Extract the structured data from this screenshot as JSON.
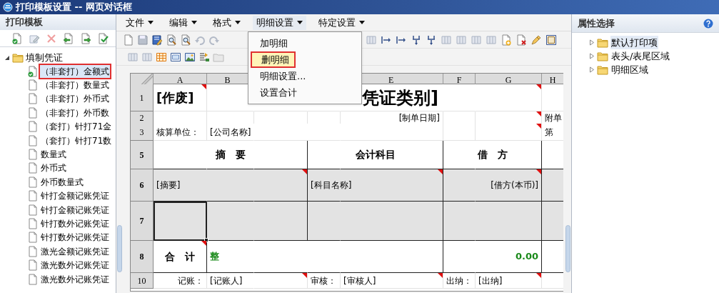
{
  "window": {
    "title": "打印模板设置 -- 网页对话框"
  },
  "left_panel": {
    "title": "打印模板",
    "tree": [
      {
        "label": "填制凭证",
        "expanded": true,
        "children": [
          {
            "label": "（非套打）金额式",
            "checked": true,
            "selected": true
          },
          {
            "label": "（非套打）数量式",
            "checked": false,
            "selected": false
          },
          {
            "label": "（非套打）外币式",
            "checked": false,
            "selected": false
          },
          {
            "label": "（非套打）外币数",
            "checked": false,
            "selected": false
          },
          {
            "label": "（套打）针打71金",
            "checked": false,
            "selected": false
          },
          {
            "label": "（套打）针打71数",
            "checked": false,
            "selected": false
          },
          {
            "label": "数量式",
            "checked": false,
            "selected": false
          },
          {
            "label": "外币式",
            "checked": false,
            "selected": false
          },
          {
            "label": "外币数量式",
            "checked": false,
            "selected": false
          },
          {
            "label": "针打金额记账凭证",
            "checked": false,
            "selected": false
          },
          {
            "label": "针打金额记账凭证",
            "checked": false,
            "selected": false
          },
          {
            "label": "针打数外记账凭证",
            "checked": false,
            "selected": false
          },
          {
            "label": "针打数外记账凭证",
            "checked": false,
            "selected": false
          },
          {
            "label": "激光金额记账凭证",
            "checked": false,
            "selected": false
          },
          {
            "label": "激光数外记账凭证",
            "checked": false,
            "selected": false
          },
          {
            "label": "激光数外记账凭证",
            "checked": false,
            "selected": false
          }
        ]
      }
    ]
  },
  "menubar": [
    {
      "label": "文件",
      "open": false
    },
    {
      "label": "编辑",
      "open": false
    },
    {
      "label": "格式",
      "open": false
    },
    {
      "label": "明细设置",
      "open": true,
      "items": [
        {
          "label": "加明细",
          "selected": false
        },
        {
          "label": "删明细",
          "selected": true
        },
        {
          "label": "明细设置...",
          "selected": false
        },
        {
          "label": "设置合计",
          "selected": false
        }
      ]
    },
    {
      "label": "特定设置",
      "open": false
    }
  ],
  "sheet": {
    "columns": [
      "A",
      "B",
      "",
      "",
      "E",
      "F",
      "G",
      "H"
    ],
    "rows": [
      {
        "number": "1",
        "kind": "plain",
        "cells": [
          {
            "text": "[作废]",
            "kind": "title-small",
            "flag": true,
            "selected": false
          },
          {
            "text": "",
            "flag": false,
            "selected": false
          },
          {
            "text": "",
            "flag": false,
            "selected": false
          },
          {
            "text": "",
            "flag": false,
            "selected": false
          },
          {
            "text": "凭证类别]",
            "kind": "title",
            "flag": false,
            "selected": false
          },
          {
            "text": "",
            "flag": false,
            "selected": false
          },
          {
            "text": "",
            "flag": true,
            "selected": false
          },
          {
            "text": "",
            "flag": false,
            "selected": false
          }
        ]
      },
      {
        "number": "2",
        "kind": "plain",
        "cells": [
          {
            "text": "",
            "flag": false,
            "selected": false
          },
          {
            "text": "",
            "flag": false,
            "selected": false
          },
          {
            "text": "",
            "flag": false,
            "selected": false
          },
          {
            "text": "",
            "flag": false,
            "selected": false
          },
          {
            "text": "[制单日期]",
            "kind": "field-right",
            "flag": false,
            "selected": false
          },
          {
            "text": "",
            "flag": false,
            "selected": false
          },
          {
            "text": "",
            "flag": true,
            "selected": false
          },
          {
            "text": "附单",
            "kind": "field",
            "flag": false,
            "selected": false
          }
        ]
      },
      {
        "number": "3",
        "kind": "plain",
        "cells": [
          {
            "text": "核算单位：",
            "kind": "field",
            "flag": false,
            "selected": false
          },
          {
            "text": "[公司名称]",
            "kind": "field",
            "flag": false,
            "selected": false
          },
          {
            "text": "",
            "flag": false,
            "selected": false
          },
          {
            "text": "",
            "flag": false,
            "selected": false
          },
          {
            "text": "",
            "flag": false,
            "selected": false
          },
          {
            "text": "",
            "flag": false,
            "selected": false
          },
          {
            "text": "",
            "flag": true,
            "selected": false
          },
          {
            "text": "第",
            "kind": "field",
            "flag": false,
            "selected": false
          }
        ]
      },
      {
        "number": "5",
        "kind": "table",
        "cells": [
          {
            "text": "",
            "flag": false,
            "selected": false
          },
          {
            "text": "摘　要",
            "kind": "heading",
            "flag": false,
            "selected": false
          },
          {
            "text": "",
            "flag": false,
            "selected": false
          },
          {
            "text": "",
            "flag": false,
            "selected": false
          },
          {
            "text": "会计科目",
            "kind": "heading",
            "flag": false,
            "selected": false
          },
          {
            "text": "",
            "flag": false,
            "selected": false
          },
          {
            "text": "借　方",
            "kind": "heading",
            "flag": false,
            "selected": false
          },
          {
            "text": "",
            "flag": false,
            "selected": false
          }
        ]
      },
      {
        "number": "6",
        "kind": "detail",
        "cells": [
          {
            "text": "[摘要]",
            "kind": "field",
            "flag": false,
            "selected": false
          },
          {
            "text": "",
            "flag": false,
            "selected": false
          },
          {
            "text": "",
            "flag": true,
            "selected": false
          },
          {
            "text": "[科目名称]",
            "kind": "field",
            "flag": false,
            "selected": false
          },
          {
            "text": "",
            "flag": true,
            "selected": false
          },
          {
            "text": "",
            "flag": false,
            "selected": false
          },
          {
            "text": "[借方(本币)]",
            "kind": "field-right",
            "flag": true,
            "selected": false
          },
          {
            "text": "",
            "flag": false,
            "selected": false
          }
        ]
      },
      {
        "number": "7",
        "kind": "detail",
        "cells": [
          {
            "text": "",
            "flag": false,
            "selected": true
          },
          {
            "text": "",
            "flag": false,
            "selected": false
          },
          {
            "text": "",
            "flag": false,
            "selected": false
          },
          {
            "text": "",
            "flag": false,
            "selected": false
          },
          {
            "text": "",
            "flag": false,
            "selected": false
          },
          {
            "text": "",
            "flag": false,
            "selected": false
          },
          {
            "text": "",
            "flag": false,
            "selected": false
          },
          {
            "text": "",
            "flag": false,
            "selected": false
          }
        ]
      },
      {
        "number": "8",
        "kind": "table",
        "cells": [
          {
            "text": "合　计",
            "kind": "heading",
            "flag": true,
            "selected": false
          },
          {
            "text": "整",
            "kind": "amount-word",
            "flag": false,
            "selected": false
          },
          {
            "text": "",
            "flag": false,
            "selected": false
          },
          {
            "text": "",
            "flag": false,
            "selected": false
          },
          {
            "text": "",
            "flag": false,
            "selected": false
          },
          {
            "text": "",
            "flag": false,
            "selected": false
          },
          {
            "text": "0.00",
            "kind": "amount",
            "flag": false,
            "selected": false
          },
          {
            "text": "",
            "flag": false,
            "selected": false
          }
        ]
      },
      {
        "number": "10",
        "kind": "plain",
        "cells": [
          {
            "text": "记账：",
            "kind": "field-right",
            "flag": false,
            "selected": false
          },
          {
            "text": "[记账人]",
            "kind": "field",
            "flag": false,
            "selected": false
          },
          {
            "text": "",
            "flag": true,
            "selected": false
          },
          {
            "text": "审核：",
            "kind": "field",
            "flag": false,
            "selected": false
          },
          {
            "text": "[审核人]",
            "kind": "field",
            "flag": true,
            "selected": false
          },
          {
            "text": "出纳：",
            "kind": "field",
            "flag": false,
            "selected": false
          },
          {
            "text": "[出纳]",
            "kind": "field",
            "flag": true,
            "selected": false
          },
          {
            "text": "",
            "flag": false,
            "selected": false
          }
        ]
      }
    ]
  },
  "right_panel": {
    "title": "属性选择",
    "tree": [
      {
        "label": "默认打印项",
        "selected": true
      },
      {
        "label": "表头/表尾区域",
        "selected": false
      },
      {
        "label": "明细区域",
        "selected": false
      }
    ]
  }
}
